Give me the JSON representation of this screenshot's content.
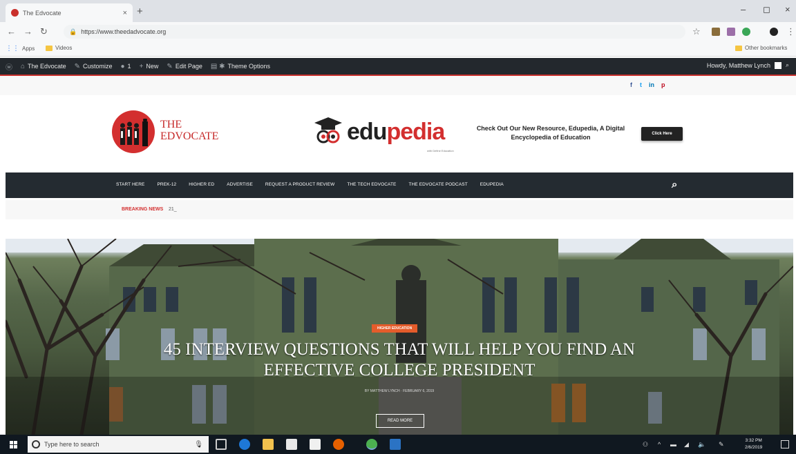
{
  "browser": {
    "tab_title": "The Edvocate",
    "tab_close": "×",
    "new_tab": "+",
    "url": "https://www.theedadvocate.org",
    "win_minimize": "–",
    "win_restore": "◻",
    "win_close": "×",
    "bookmarks": [
      {
        "label": "Apps"
      },
      {
        "label": "Videos"
      }
    ],
    "other_bookmarks": "Other bookmarks"
  },
  "admin_bar": {
    "items": [
      {
        "label": "The Edvocate"
      },
      {
        "label": "Customize"
      },
      {
        "label": "1"
      },
      {
        "label": "New"
      },
      {
        "label": "Edit Page"
      },
      {
        "label": "Theme Options"
      }
    ],
    "greeting": "Howdy, Matthew Lynch"
  },
  "social": [
    "f",
    "t",
    "in",
    "p"
  ],
  "header": {
    "logo_line1": "THE",
    "logo_line2": "EDVOCATE",
    "edu_part1": "edu",
    "edu_part2": "pedia",
    "edu_tagline": "with Define Education",
    "promo_text": "Check Out Our New Resource, Edupedia, A Digital Encyclopedia of Education",
    "promo_button": "Click Here"
  },
  "nav": {
    "items": [
      "START HERE",
      "PREK-12",
      "HIGHER ED",
      "ADVERTISE",
      "REQUEST A PRODUCT REVIEW",
      "THE TECH EDVOCATE",
      "THE EDVOCATE PODCAST",
      "EDUPEDIA"
    ]
  },
  "breaking": {
    "label": "BREAKING NEWS",
    "value": "21_"
  },
  "hero": {
    "category": "HIGHER EDUCATION",
    "title_line1": "45 INTERVIEW QUESTIONS THAT WILL HELP YOU FIND AN",
    "title_line2": "EFFECTIVE COLLEGE PRESIDENT",
    "meta": "BY MATTHEW LYNCH · FEBRUARY 6, 2019",
    "button": "READ MORE"
  },
  "taskbar": {
    "search_placeholder": "Type here to search",
    "time": "3:32 PM",
    "date": "2/6/2019"
  },
  "colors": {
    "brand_red": "#d32f2f",
    "nav_dark": "#242b31",
    "admin_bar": "#23282d",
    "accent_orange": "#e45c2b"
  }
}
